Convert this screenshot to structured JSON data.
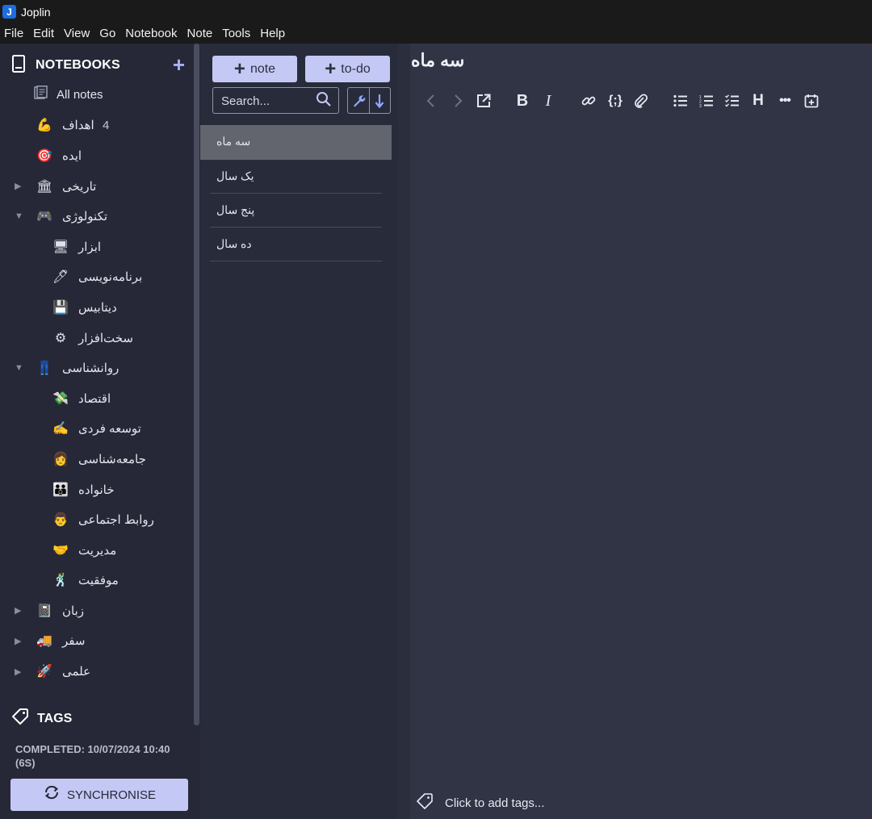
{
  "app": {
    "title": "Joplin",
    "logo": "J"
  },
  "menu": [
    "File",
    "Edit",
    "View",
    "Go",
    "Notebook",
    "Note",
    "Tools",
    "Help"
  ],
  "sidebar": {
    "notebooks_label": "NOTEBOOKS",
    "all_notes": {
      "label": "All notes",
      "icon": "notes-icon"
    },
    "items": [
      {
        "label": "اهداف",
        "emoji": "💪",
        "count": "4",
        "level": 0,
        "arrow": ""
      },
      {
        "label": "ایده",
        "emoji": "🎯",
        "level": 0,
        "arrow": ""
      },
      {
        "label": "تاریخی",
        "emoji": "🏛",
        "level": 0,
        "arrow": "▶"
      },
      {
        "label": "تکنولوژی",
        "emoji": "🎮",
        "level": 0,
        "arrow": "▼"
      },
      {
        "label": "ابزار",
        "emoji": "🖥",
        "level": 1,
        "arrow": ""
      },
      {
        "label": "برنامه‌نویسی",
        "emoji": "🖊",
        "level": 1,
        "arrow": ""
      },
      {
        "label": "دیتابیس",
        "emoji": "💾",
        "level": 1,
        "arrow": ""
      },
      {
        "label": "سخت‌افزار",
        "emoji": "⚙",
        "level": 1,
        "arrow": ""
      },
      {
        "label": "روانشناسی",
        "emoji": "👖",
        "level": 0,
        "arrow": "▼"
      },
      {
        "label": "اقتصاد",
        "emoji": "💸",
        "level": 1,
        "arrow": ""
      },
      {
        "label": "توسعه فردی",
        "emoji": "✍",
        "level": 1,
        "arrow": ""
      },
      {
        "label": "جامعه‌شناسی",
        "emoji": "👩",
        "level": 1,
        "arrow": ""
      },
      {
        "label": "خانواده",
        "emoji": "👪",
        "level": 1,
        "arrow": ""
      },
      {
        "label": "روابط اجتماعی",
        "emoji": "👨",
        "level": 1,
        "arrow": ""
      },
      {
        "label": "مدیریت",
        "emoji": "🤝",
        "level": 1,
        "arrow": ""
      },
      {
        "label": "موفقیت",
        "emoji": "🕺",
        "level": 1,
        "arrow": ""
      },
      {
        "label": "زبان",
        "emoji": "📓",
        "level": 0,
        "arrow": "▶"
      },
      {
        "label": "سفر",
        "emoji": "🚚",
        "level": 0,
        "arrow": "▶"
      },
      {
        "label": "علمی",
        "emoji": "🚀",
        "level": 0,
        "arrow": "▶"
      }
    ],
    "tags_label": "TAGS",
    "sync_status": "COMPLETED: 10/07/2024 10:40 (6S)",
    "sync_button": "SYNCHRONISE"
  },
  "notelist": {
    "new_note": "note",
    "new_todo": "to-do",
    "search_placeholder": "Search...",
    "notes": [
      "سه ماه",
      "یک سال",
      "پنج سال",
      "ده سال"
    ],
    "selected_index": 0
  },
  "editor": {
    "title": "سه ماه",
    "tag_prompt": "Click to add tags...",
    "toolbar": [
      "back-icon",
      "forward-icon",
      "external-edit-icon",
      "bold-icon",
      "italic-icon",
      "link-icon",
      "code-icon",
      "attach-icon",
      "bullet-list-icon",
      "numbered-list-icon",
      "checklist-icon",
      "heading-icon",
      "more-icon",
      "insert-date-icon"
    ]
  },
  "colors": {
    "accent": "#c4c8f4",
    "sidebar_bg": "#262837",
    "notelist_bg": "#282b3a",
    "editor_bg": "#313445",
    "selected_note_bg": "#62646e"
  }
}
